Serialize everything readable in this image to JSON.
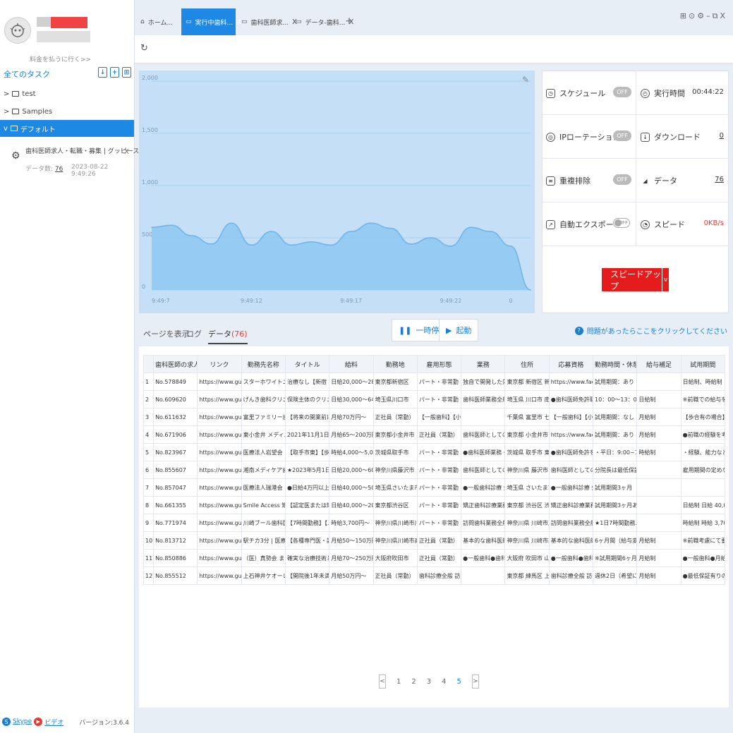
{
  "sidebar": {
    "pay_link": "料金を払うに行く>>",
    "all_tasks": "全てのタスク",
    "folders": [
      {
        "label": "test",
        "prefix": ">"
      },
      {
        "label": "Samples",
        "prefix": ">"
      },
      {
        "label": "デフォルト",
        "prefix": "v"
      }
    ],
    "task": {
      "title": "歯科医師求人・転職・募集 | グッピースク...",
      "count_label": "データ数:",
      "count": "76",
      "date": "2023-08-22 9:49:26",
      "close": "X"
    },
    "footer": {
      "skype": "Skype",
      "video": "ビデオ",
      "version": "バージョン:3.6.4"
    }
  },
  "tabs": [
    {
      "label": "ホーム...",
      "close": ""
    },
    {
      "label": "実行中歯科...",
      "close": "X"
    },
    {
      "label": "歯科医師求...",
      "close": "X"
    },
    {
      "label": "データ-歯科...",
      "close": "X"
    }
  ],
  "tab_plus": "+",
  "stats": {
    "schedule": {
      "label": "スケジュール",
      "state": "OFF"
    },
    "runtime": {
      "label": "実行時間",
      "value": "00:44:22"
    },
    "ip_rotation": {
      "label": "IPローテーション",
      "state": "OFF"
    },
    "download": {
      "label": "ダウンロード",
      "value": "0"
    },
    "dedupe": {
      "label": "重複排除",
      "state": "OFF"
    },
    "data": {
      "label": "データ",
      "value": "76"
    },
    "auto_export": {
      "label": "自動エクスポート",
      "state": "OFF"
    },
    "speed": {
      "label": "スピード",
      "value": "0KB/s"
    },
    "speed_up": "スピードアップ"
  },
  "subtabs": {
    "page": "ページを表示",
    "log": "ログ",
    "data": "データ",
    "data_count": "(76)"
  },
  "controls": {
    "pause": "一時停止",
    "start": "起動"
  },
  "help": "問題があったらここをクリックしてください",
  "chart_data": {
    "type": "area",
    "x": [
      "9:49:7",
      "9:49:8",
      "9:49:9",
      "9:49:10",
      "9:49:11",
      "9:49:12",
      "9:49:13",
      "9:49:14",
      "9:49:15",
      "9:49:16",
      "9:49:17",
      "9:49:18",
      "9:49:19",
      "9:49:20",
      "9:49:21",
      "9:49:22",
      "9:49:23",
      "9:49:24",
      "9:49:25",
      "9:49:26"
    ],
    "x_ticks": [
      "9:49:7",
      "9:49:12",
      "9:49:17",
      "9:49:22",
      "0"
    ],
    "values": [
      600,
      620,
      520,
      440,
      640,
      430,
      560,
      430,
      460,
      430,
      560,
      640,
      590,
      440,
      500,
      420,
      600,
      560,
      420,
      0
    ],
    "y_ticks": [
      "0",
      "500",
      "1,000",
      "1,500",
      "2,000"
    ],
    "ylim": [
      0,
      2000
    ],
    "grid": true,
    "color": "#8ec8f2"
  },
  "table": {
    "headers": [
      "",
      "歯科医師の求人",
      "リンク",
      "勤務先名称",
      "タイトル",
      "給料",
      "勤務地",
      "雇用形態",
      "業務",
      "住所",
      "応募資格",
      "勤務時間・休憩",
      "給与補足",
      "試用期間"
    ],
    "rows": [
      [
        "1",
        "No.578849",
        "https://www.guppy...",
        "スターホワイトニ...",
        "治療なし【新宿・...",
        "日給20,000～28.0...",
        "東京都新宿区",
        "パート・非常勤",
        "独自で開発した効...",
        "東京都 新宿区 新宿...",
        "https://www.faceb...",
        "試用期間：あり 試...",
        "",
        "日給制、時給制 日..."
      ],
      [
        "2",
        "No.609620",
        "https://www.guppy...",
        "げんき歯科クリニ...",
        "保険主体のクリニ...",
        "日給30,000～64.0...",
        "埼玉県川口市",
        "パート・非常勤",
        "歯科医師業務全般",
        "埼玉県 川口市 南鳩...",
        "●歯科医師免許取...",
        "10：00～13：00 /...",
        "日給制",
        "※前職での給与を..."
      ],
      [
        "3",
        "No.611632",
        "https://www.guppy...",
        "富里ファミリー歯科...",
        "【将来の開業前に...",
        "月給70万円～",
        "正社員（常勤）",
        "【一般歯科】【小...",
        "",
        "千葉県 富里市 七栄...",
        "【一般歯科】【小...",
        "試用期間：なし",
        "月給制",
        "【歩合有の場合】..."
      ],
      [
        "4",
        "No.671906",
        "https://www.guppy...",
        "東小金井 メディ...",
        "2021年11月1日新...",
        "月給65～200万円",
        "東京都小金井市",
        "正社員（常勤）",
        "歯科医師としての...",
        "東京都 小金井市 東...",
        "https://www.faceb...",
        "試用期間：あり 試...",
        "月給制",
        "●前職の経験を考..."
      ],
      [
        "5",
        "No.823967",
        "https://www.guppy...",
        "医療法人岩望会 ...",
        "【取手市東】【歩...",
        "時給4,000～5,000...",
        "茨城県取手市",
        "パート・非常勤",
        "●歯科医師業務・...",
        "茨城県 取手市 東4...",
        "●歯科医師免許を...",
        "・平日：9:00~13...",
        "時給制",
        "・経験、能力など..."
      ],
      [
        "6",
        "No.855607",
        "https://www.guppy...",
        "湘南メディケア歯...",
        "★2023年5月1日...",
        "日給20,000～60.0...",
        "神奈川県藤沢市",
        "パート・非常勤",
        "歯科医師としての...",
        "神奈川県 藤沢市 石...",
        "歯科医師としての...",
        "分院長は最低保証...",
        "",
        "雇用期間の定めな..."
      ],
      [
        "7",
        "No.857047",
        "https://www.guppy...",
        "医療法人瑞港会 ...",
        "●日給4万円以上●...",
        "日給40,000～50.0...",
        "埼玉県さいたま市...",
        "パート・非常勤",
        "●一般歯科診療 外...",
        "埼玉県 さいたま市...",
        "●一般歯科診療 外...",
        "試用期間3ヶ月",
        "",
        ""
      ],
      [
        "8",
        "No.661355",
        "https://www.guppy...",
        "Smile Access 矯正...",
        "【認定医または矯...",
        "日給40,000～200,...",
        "東京都渋谷区",
        "パート・非常勤",
        "矯正歯科診療業務...",
        "東京都 渋谷区 渋谷...",
        "矯正歯科診療業務...",
        "試用期間3ヶ月あ...",
        "",
        "日給制 日給 40,0..."
      ],
      [
        "9",
        "No.771974",
        "https://www.guppy...",
        "川崎ブール歯科医院",
        "【7時間勤務】【...",
        "時給3,700円～",
        "神奈川県川崎市川...",
        "パート・非常勤",
        "訪問歯科業務全般...",
        "神奈川県 川崎市川...",
        "訪問歯科業務全般...",
        "★1日7時間勤務...",
        "",
        "時給制 時給 3,70..."
      ],
      [
        "10",
        "No.813712",
        "https://www.guppy...",
        "駅チカ3分 | 医療...",
        "【各種専門医・認...",
        "月給50～150万円",
        "神奈川県川崎市高...",
        "正社員（常勤）",
        "基本的な歯科医師...",
        "神奈川県 川崎市高...",
        "基本的な歯科医師...",
        "6ヶ月間（給与変...",
        "月給制",
        "※前職考慮にて要..."
      ],
      [
        "11",
        "No.850886",
        "https://www.guppy...",
        "（医）真勢会 ま...",
        "確実な治療技術と...",
        "月給70～250万円",
        "大阪府吹田市",
        "正社員（常勤）",
        "●一般歯科●歯科治...",
        "大阪府 吹田市 山田...",
        "●一般歯科●歯科治...",
        "※試用期間6ヶ月...",
        "月給制",
        "●一般歯科●月給7..."
      ],
      [
        "12",
        "No.855512",
        "https://www.guppy...",
        "上石神井ケオーレ...",
        "【開院後1年未満...",
        "月給50万円～",
        "正社員（常勤）",
        "歯科診療全般 訪問...",
        "",
        "東京都 練馬区 上石...",
        "歯科診療全般 訪問...",
        "週休2日（希望に...",
        "月給制",
        "●最低保証有りの..."
      ]
    ]
  },
  "pager": {
    "prev": "<",
    "pages": [
      "1",
      "2",
      "3",
      "4",
      "5"
    ],
    "current": "5",
    "next": ">"
  }
}
